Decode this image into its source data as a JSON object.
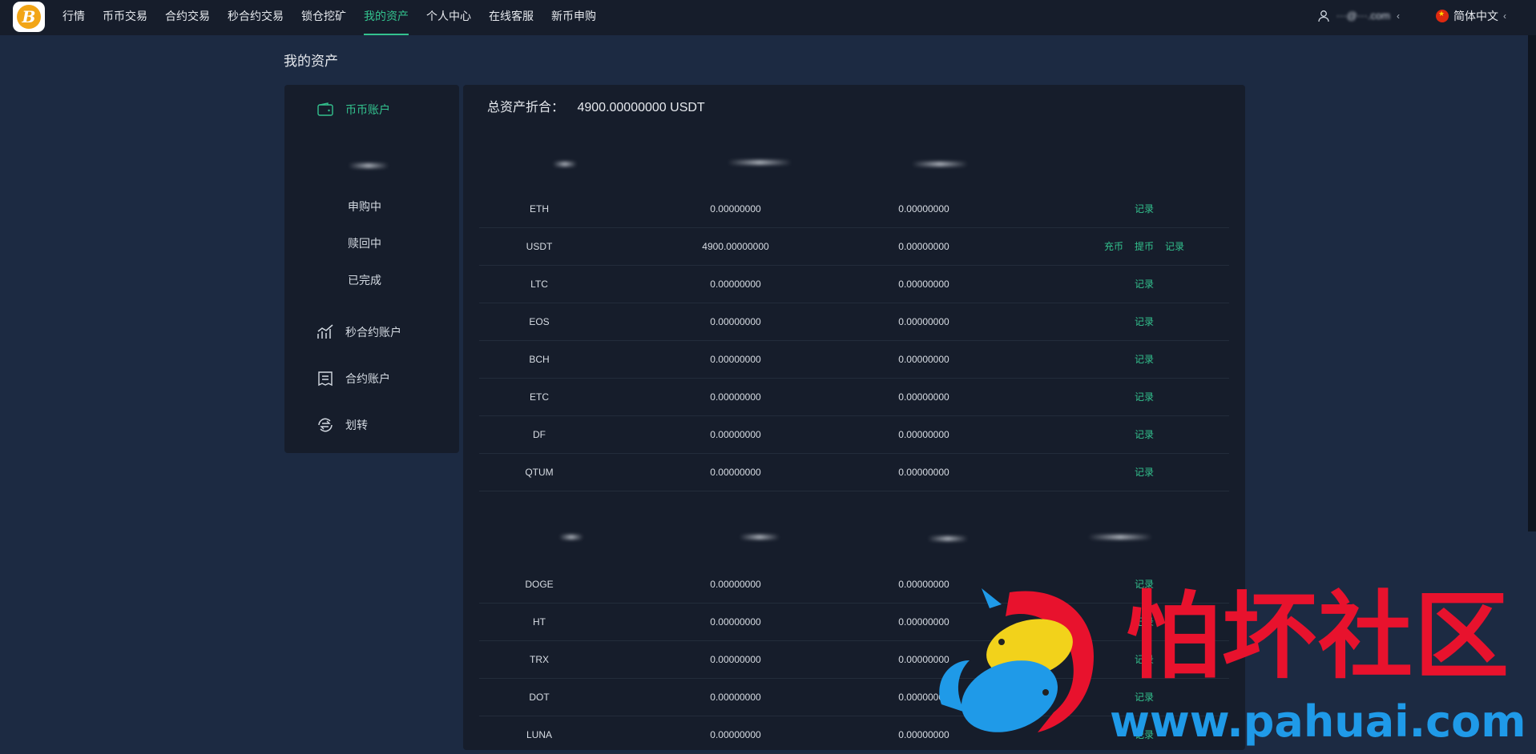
{
  "nav": {
    "items": [
      "行情",
      "币币交易",
      "合约交易",
      "秒合约交易",
      "锁仓挖矿",
      "我的资产",
      "个人中心",
      "在线客服",
      "新币申购"
    ],
    "active_index": 5,
    "user_label": "···@···.com",
    "language": "简体中文"
  },
  "page": {
    "title": "我的资产",
    "total_label": "总资产折合：",
    "total_value": "4900.00000000 USDT"
  },
  "sidebar": {
    "items": [
      {
        "label": "币币账户",
        "icon": "wallet-icon"
      },
      {
        "label": "申购中"
      },
      {
        "label": "赎回中"
      },
      {
        "label": "已完成"
      },
      {
        "label": "秒合约账户",
        "icon": "chart-icon"
      },
      {
        "label": "合约账户",
        "icon": "document-icon"
      },
      {
        "label": "划转",
        "icon": "transfer-icon"
      }
    ]
  },
  "table1": {
    "rows": [
      {
        "coin": "ETH",
        "v1": "0.00000000",
        "v2": "0.00000000",
        "actions": [
          "记录"
        ]
      },
      {
        "coin": "USDT",
        "v1": "4900.00000000",
        "v2": "0.00000000",
        "actions": [
          "充币",
          "提币",
          "记录"
        ]
      },
      {
        "coin": "LTC",
        "v1": "0.00000000",
        "v2": "0.00000000",
        "actions": [
          "记录"
        ]
      },
      {
        "coin": "EOS",
        "v1": "0.00000000",
        "v2": "0.00000000",
        "actions": [
          "记录"
        ]
      },
      {
        "coin": "BCH",
        "v1": "0.00000000",
        "v2": "0.00000000",
        "actions": [
          "记录"
        ]
      },
      {
        "coin": "ETC",
        "v1": "0.00000000",
        "v2": "0.00000000",
        "actions": [
          "记录"
        ]
      },
      {
        "coin": "DF",
        "v1": "0.00000000",
        "v2": "0.00000000",
        "actions": [
          "记录"
        ]
      },
      {
        "coin": "QTUM",
        "v1": "0.00000000",
        "v2": "0.00000000",
        "actions": [
          "记录"
        ]
      }
    ]
  },
  "table2": {
    "rows": [
      {
        "coin": "DOGE",
        "v1": "0.00000000",
        "v2": "0.00000000",
        "actions": [
          "记录"
        ]
      },
      {
        "coin": "HT",
        "v1": "0.00000000",
        "v2": "0.00000000",
        "actions": [
          "记录"
        ]
      },
      {
        "coin": "TRX",
        "v1": "0.00000000",
        "v2": "0.00000000",
        "actions": [
          "记录"
        ]
      },
      {
        "coin": "DOT",
        "v1": "0.00000000",
        "v2": "0.00000000",
        "actions": [
          "记录"
        ]
      },
      {
        "coin": "LUNA",
        "v1": "0.00000000",
        "v2": "0.00000000",
        "actions": [
          "记录"
        ]
      }
    ]
  },
  "watermark": {
    "text": "怕坏社区",
    "url": "www.pahuai.com"
  },
  "colors": {
    "accent": "#33c28e",
    "background": "#1c2a42",
    "panel": "#161d2b",
    "watermark_red": "#e8122d",
    "watermark_blue": "#1f9ae8"
  }
}
